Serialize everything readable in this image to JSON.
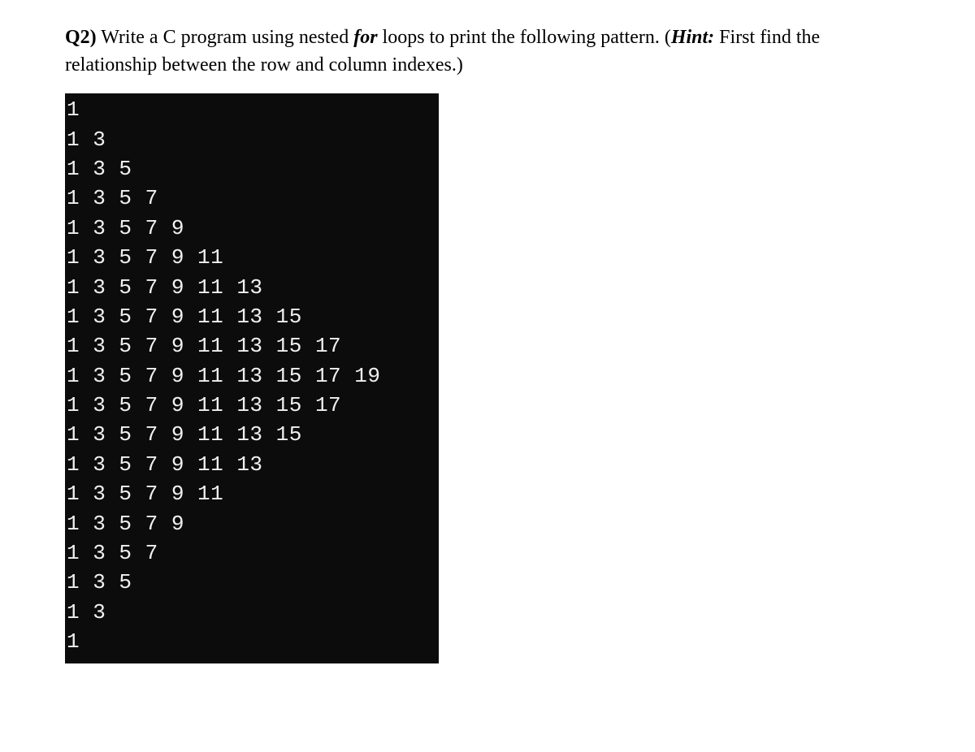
{
  "question": {
    "label": "Q2)",
    "text_part1": " Write a C program using nested ",
    "for_word": "for",
    "text_part2": " loops to print the following pattern. (",
    "hint_label": "Hint:",
    "hint_text": " First find the relationship between the row and column indexes.)"
  },
  "pattern": {
    "lines": [
      "1",
      "1 3",
      "1 3 5",
      "1 3 5 7",
      "1 3 5 7 9",
      "1 3 5 7 9 11",
      "1 3 5 7 9 11 13",
      "1 3 5 7 9 11 13 15",
      "1 3 5 7 9 11 13 15 17",
      "1 3 5 7 9 11 13 15 17 19",
      "1 3 5 7 9 11 13 15 17",
      "1 3 5 7 9 11 13 15",
      "1 3 5 7 9 11 13",
      "1 3 5 7 9 11",
      "1 3 5 7 9",
      "1 3 5 7",
      "1 3 5",
      "1 3",
      "1"
    ]
  }
}
